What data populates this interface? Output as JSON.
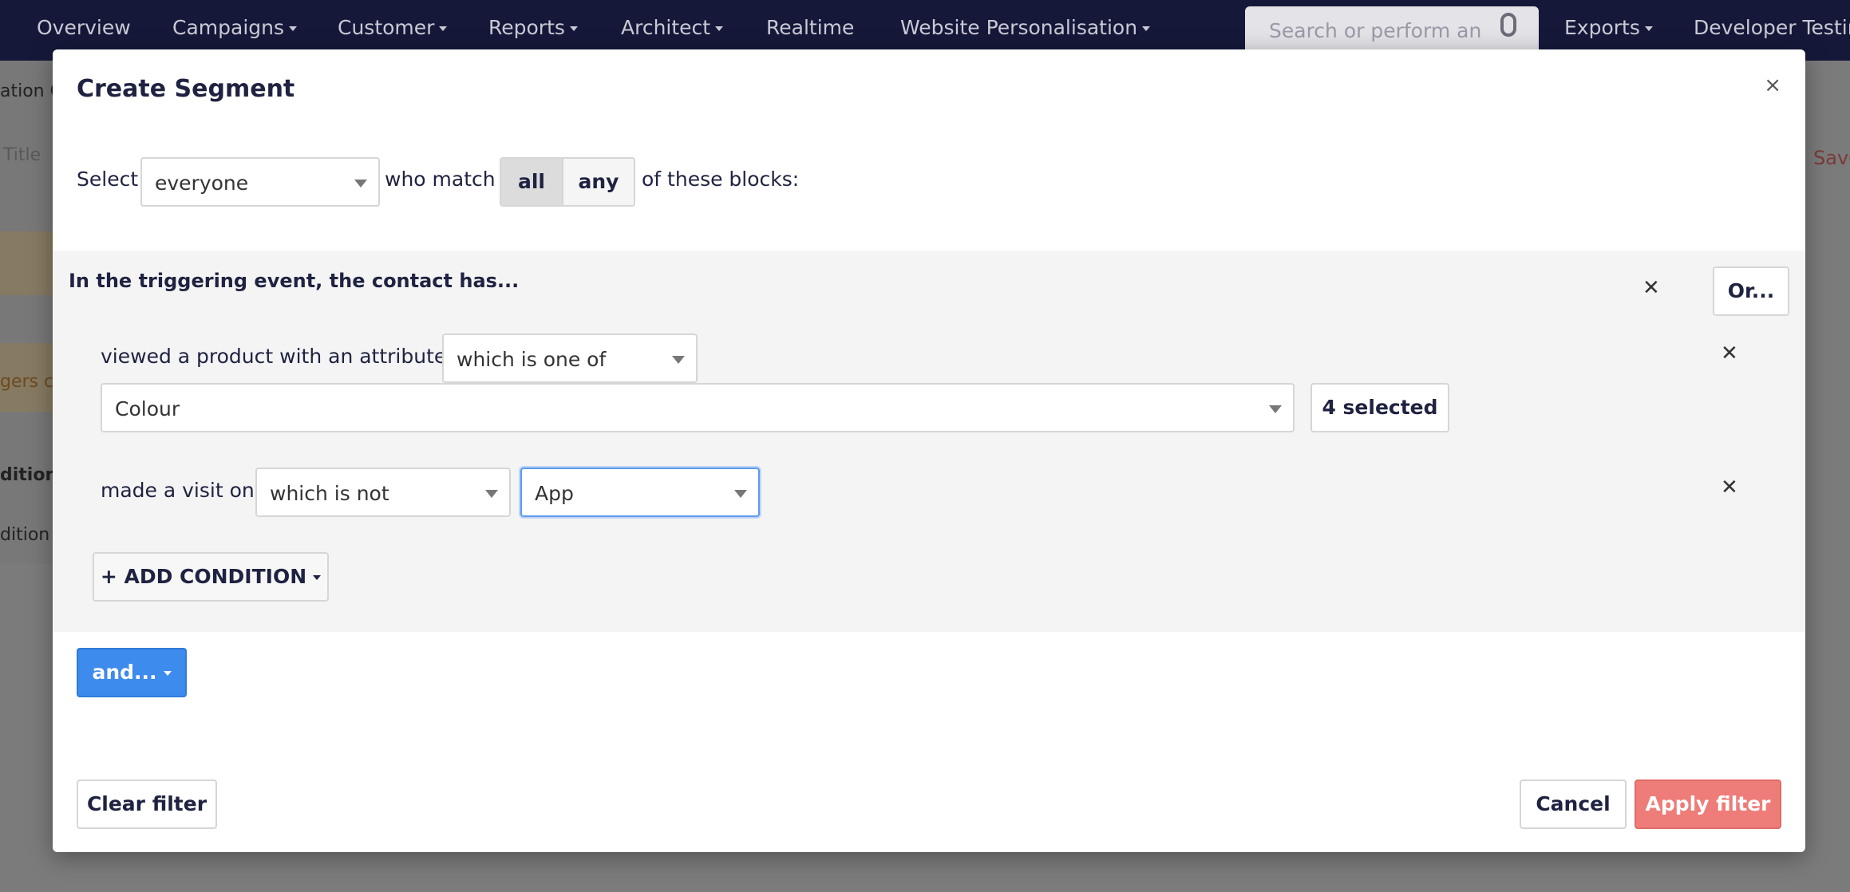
{
  "nav": {
    "items": [
      {
        "label": "Overview",
        "dropdown": false
      },
      {
        "label": "Campaigns",
        "dropdown": true
      },
      {
        "label": "Customer",
        "dropdown": true
      },
      {
        "label": "Reports",
        "dropdown": true
      },
      {
        "label": "Architect",
        "dropdown": true
      },
      {
        "label": "Realtime",
        "dropdown": false
      },
      {
        "label": "Website Personalisation",
        "dropdown": true
      }
    ],
    "search_placeholder": "Search or perform an",
    "exports_label": "Exports",
    "developer_label": "Developer Testin"
  },
  "background": {
    "text1": "ation C",
    "title_placeholder": "Title",
    "orange_text": "gers c",
    "text2": "dition",
    "text3": "dition",
    "save": "Save"
  },
  "modal": {
    "title": "Create Segment",
    "close": "×",
    "select_label": "Select",
    "audience_value": "everyone",
    "who_match": "who match",
    "match_all": "all",
    "match_any": "any",
    "of_blocks": "of these blocks:",
    "block": {
      "title": "In the triggering event, the contact has...",
      "or_button": "Or...",
      "condition1": {
        "label": "viewed a product with an attribute",
        "operator": "which is one of",
        "attribute": "Colour",
        "selected": "4 selected"
      },
      "condition2": {
        "label": "made a visit on",
        "operator": "which is not",
        "value": "App"
      },
      "add_condition": "+ ADD CONDITION"
    },
    "and_button": "and...",
    "clear_filter": "Clear filter",
    "cancel": "Cancel",
    "apply": "Apply filter"
  },
  "colors": {
    "nav_bg": "#16183a",
    "primary_blue": "#3d8bec",
    "apply_red": "#ee7c78"
  }
}
